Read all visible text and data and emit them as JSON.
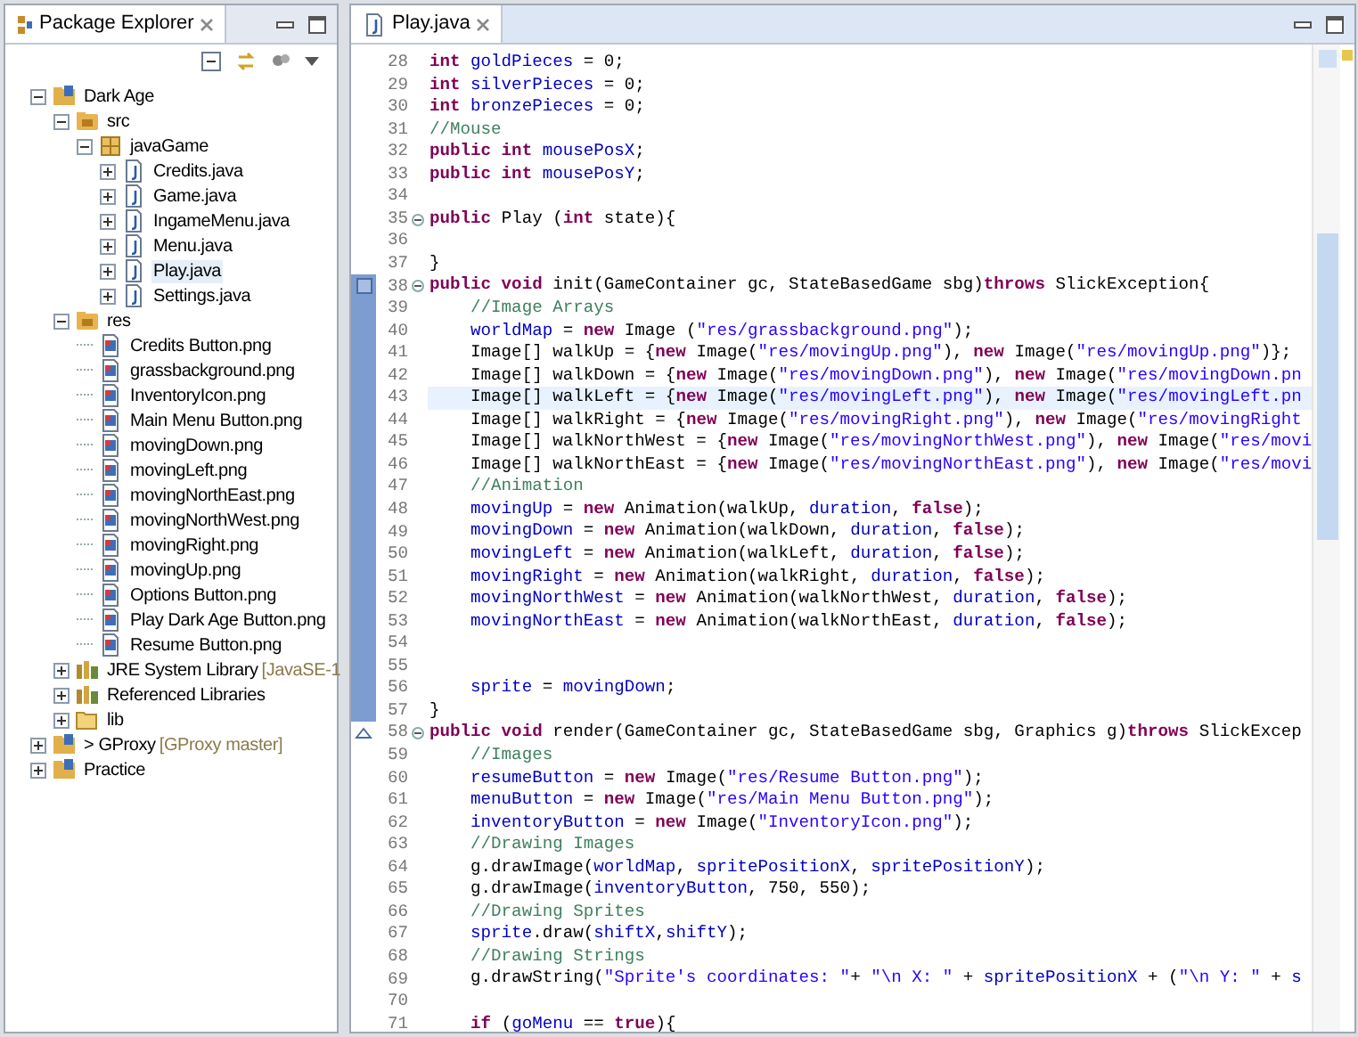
{
  "package_explorer": {
    "title": "Package Explorer",
    "tree": [
      {
        "label": "Dark Age",
        "kind": "project",
        "expanded": true,
        "selected": false,
        "children": [
          {
            "label": "src",
            "kind": "source_folder",
            "expanded": true,
            "selected": false,
            "children": [
              {
                "label": "javaGame",
                "kind": "package",
                "expanded": true,
                "selected": false,
                "children": [
                  {
                    "label": "Credits.java",
                    "kind": "java_file",
                    "expanded": false,
                    "selected": false
                  },
                  {
                    "label": "Game.java",
                    "kind": "java_file",
                    "expanded": false,
                    "selected": false
                  },
                  {
                    "label": "IngameMenu.java",
                    "kind": "java_file",
                    "expanded": false,
                    "selected": false
                  },
                  {
                    "label": "Menu.java",
                    "kind": "java_file",
                    "expanded": false,
                    "selected": false
                  },
                  {
                    "label": "Play.java",
                    "kind": "java_file",
                    "expanded": false,
                    "selected": true
                  },
                  {
                    "label": "Settings.java",
                    "kind": "java_file",
                    "expanded": false,
                    "selected": false
                  }
                ]
              }
            ]
          },
          {
            "label": "res",
            "kind": "source_folder",
            "expanded": true,
            "selected": false,
            "children": [
              {
                "label": "Credits Button.png",
                "kind": "image_file",
                "selected": false
              },
              {
                "label": "grassbackground.png",
                "kind": "image_file",
                "selected": false
              },
              {
                "label": "InventoryIcon.png",
                "kind": "image_file",
                "selected": false
              },
              {
                "label": "Main Menu Button.png",
                "kind": "image_file",
                "selected": false
              },
              {
                "label": "movingDown.png",
                "kind": "image_file",
                "selected": false
              },
              {
                "label": "movingLeft.png",
                "kind": "image_file",
                "selected": false
              },
              {
                "label": "movingNorthEast.png",
                "kind": "image_file",
                "selected": false
              },
              {
                "label": "movingNorthWest.png",
                "kind": "image_file",
                "selected": false
              },
              {
                "label": "movingRight.png",
                "kind": "image_file",
                "selected": false
              },
              {
                "label": "movingUp.png",
                "kind": "image_file",
                "selected": false
              },
              {
                "label": "Options Button.png",
                "kind": "image_file",
                "selected": false
              },
              {
                "label": "Play Dark Age Button.png",
                "kind": "image_file",
                "selected": false
              },
              {
                "label": "Resume Button.png",
                "kind": "image_file",
                "selected": false
              }
            ]
          },
          {
            "label": "JRE System Library",
            "decoration": "[JavaSE-1",
            "kind": "library",
            "expanded": false,
            "selected": false
          },
          {
            "label": "Referenced Libraries",
            "kind": "library",
            "expanded": false,
            "selected": false
          },
          {
            "label": "lib",
            "kind": "folder",
            "expanded": false,
            "selected": false
          }
        ]
      },
      {
        "label": "> GProxy",
        "decoration": "[GProxy master]",
        "kind": "project",
        "expanded": false,
        "selected": false
      },
      {
        "label": "Practice",
        "kind": "project",
        "expanded": false,
        "selected": false
      }
    ]
  },
  "editor": {
    "tabs": [
      {
        "label": "Play.java",
        "selected": true
      }
    ],
    "lines": [
      {
        "number": "28",
        "fold": false,
        "current": false,
        "range": false,
        "tokens": [
          {
            "kind": "keyword",
            "text": "int "
          },
          {
            "kind": "field",
            "text": "goldPieces"
          },
          {
            "kind": "plain",
            "text": " = 0;"
          }
        ]
      },
      {
        "number": "29",
        "fold": false,
        "current": false,
        "range": false,
        "tokens": [
          {
            "kind": "keyword",
            "text": "int "
          },
          {
            "kind": "field",
            "text": "silverPieces"
          },
          {
            "kind": "plain",
            "text": " = 0;"
          }
        ]
      },
      {
        "number": "30",
        "fold": false,
        "current": false,
        "range": false,
        "tokens": [
          {
            "kind": "keyword",
            "text": "int "
          },
          {
            "kind": "field",
            "text": "bronzePieces"
          },
          {
            "kind": "plain",
            "text": " = 0;"
          }
        ]
      },
      {
        "number": "31",
        "fold": false,
        "current": false,
        "range": false,
        "tokens": [
          {
            "kind": "comment",
            "text": "//Mouse"
          }
        ]
      },
      {
        "number": "32",
        "fold": false,
        "current": false,
        "range": false,
        "tokens": [
          {
            "kind": "keyword",
            "text": "public int "
          },
          {
            "kind": "field",
            "text": "mousePosX"
          },
          {
            "kind": "plain",
            "text": ";"
          }
        ]
      },
      {
        "number": "33",
        "fold": false,
        "current": false,
        "range": false,
        "tokens": [
          {
            "kind": "keyword",
            "text": "public int "
          },
          {
            "kind": "field",
            "text": "mousePosY"
          },
          {
            "kind": "plain",
            "text": ";"
          }
        ]
      },
      {
        "number": "34",
        "fold": false,
        "current": false,
        "range": false
      },
      {
        "number": "35",
        "fold": true,
        "current": false,
        "range": false,
        "tokens": [
          {
            "kind": "keyword",
            "text": "public "
          },
          {
            "kind": "plain",
            "text": "Play ("
          },
          {
            "kind": "keyword",
            "text": "int "
          },
          {
            "kind": "plain",
            "text": "state){"
          }
        ]
      },
      {
        "number": "36",
        "fold": false,
        "current": false,
        "range": false
      },
      {
        "number": "37",
        "fold": false,
        "current": false,
        "range": false,
        "tokens": [
          {
            "kind": "plain",
            "text": "}"
          }
        ]
      },
      {
        "number": "38",
        "fold": true,
        "current": false,
        "range": true,
        "occurrence_mark": true,
        "tokens": [
          {
            "kind": "keyword",
            "text": "public void "
          },
          {
            "kind": "plain",
            "text": "init(GameContainer gc, StateBasedGame sbg)"
          },
          {
            "kind": "keyword",
            "text": "throws "
          },
          {
            "kind": "plain",
            "text": "SlickException{"
          }
        ]
      },
      {
        "number": "39",
        "fold": false,
        "current": false,
        "range": true,
        "tokens": [
          {
            "kind": "comment",
            "text": "    //Image Arrays"
          }
        ]
      },
      {
        "number": "40",
        "fold": false,
        "current": false,
        "range": true,
        "tokens": [
          {
            "kind": "field",
            "text": "    worldMap"
          },
          {
            "kind": "plain",
            "text": " = "
          },
          {
            "kind": "keyword",
            "text": "new "
          },
          {
            "kind": "plain",
            "text": "Image ("
          },
          {
            "kind": "string",
            "text": "\"res/grassbackground.png\""
          },
          {
            "kind": "plain",
            "text": ");"
          }
        ]
      },
      {
        "number": "41",
        "fold": false,
        "current": false,
        "range": true,
        "tokens": [
          {
            "kind": "plain",
            "text": "    Image[] walkUp = {"
          },
          {
            "kind": "keyword",
            "text": "new "
          },
          {
            "kind": "plain",
            "text": "Image("
          },
          {
            "kind": "string",
            "text": "\"res/movingUp.png\""
          },
          {
            "kind": "plain",
            "text": "), "
          },
          {
            "kind": "keyword",
            "text": "new "
          },
          {
            "kind": "plain",
            "text": "Image("
          },
          {
            "kind": "string",
            "text": "\"res/movingUp.png\""
          },
          {
            "kind": "plain",
            "text": ")};"
          }
        ]
      },
      {
        "number": "42",
        "fold": false,
        "current": false,
        "range": true,
        "tokens": [
          {
            "kind": "plain",
            "text": "    Image[] walkDown = {"
          },
          {
            "kind": "keyword",
            "text": "new "
          },
          {
            "kind": "plain",
            "text": "Image("
          },
          {
            "kind": "string",
            "text": "\"res/movingDown.png\""
          },
          {
            "kind": "plain",
            "text": "), "
          },
          {
            "kind": "keyword",
            "text": "new "
          },
          {
            "kind": "plain",
            "text": "Image("
          },
          {
            "kind": "string",
            "text": "\"res/movingDown.pn"
          }
        ]
      },
      {
        "number": "43",
        "fold": false,
        "current": true,
        "range": true,
        "tokens": [
          {
            "kind": "plain",
            "text": "    Image[] walkLeft = {"
          },
          {
            "kind": "keyword",
            "text": "new "
          },
          {
            "kind": "plain",
            "text": "Image("
          },
          {
            "kind": "string",
            "text": "\"res/movingLeft.png\""
          },
          {
            "kind": "plain",
            "text": "), "
          },
          {
            "kind": "keyword",
            "text": "new "
          },
          {
            "kind": "plain",
            "text": "Image("
          },
          {
            "kind": "string",
            "text": "\"res/movingLeft.pn"
          }
        ]
      },
      {
        "number": "44",
        "fold": false,
        "current": false,
        "range": true,
        "tokens": [
          {
            "kind": "plain",
            "text": "    Image[] walkRight = {"
          },
          {
            "kind": "keyword",
            "text": "new "
          },
          {
            "kind": "plain",
            "text": "Image("
          },
          {
            "kind": "string",
            "text": "\"res/movingRight.png\""
          },
          {
            "kind": "plain",
            "text": "), "
          },
          {
            "kind": "keyword",
            "text": "new "
          },
          {
            "kind": "plain",
            "text": "Image("
          },
          {
            "kind": "string",
            "text": "\"res/movingRight"
          }
        ]
      },
      {
        "number": "45",
        "fold": false,
        "current": false,
        "range": true,
        "tokens": [
          {
            "kind": "plain",
            "text": "    Image[] walkNorthWest = {"
          },
          {
            "kind": "keyword",
            "text": "new "
          },
          {
            "kind": "plain",
            "text": "Image("
          },
          {
            "kind": "string",
            "text": "\"res/movingNorthWest.png\""
          },
          {
            "kind": "plain",
            "text": "), "
          },
          {
            "kind": "keyword",
            "text": "new "
          },
          {
            "kind": "plain",
            "text": "Image("
          },
          {
            "kind": "string",
            "text": "\"res/movi"
          }
        ]
      },
      {
        "number": "46",
        "fold": false,
        "current": false,
        "range": true,
        "tokens": [
          {
            "kind": "plain",
            "text": "    Image[] walkNorthEast = {"
          },
          {
            "kind": "keyword",
            "text": "new "
          },
          {
            "kind": "plain",
            "text": "Image("
          },
          {
            "kind": "string",
            "text": "\"res/movingNorthEast.png\""
          },
          {
            "kind": "plain",
            "text": "), "
          },
          {
            "kind": "keyword",
            "text": "new "
          },
          {
            "kind": "plain",
            "text": "Image("
          },
          {
            "kind": "string",
            "text": "\"res/movi"
          }
        ]
      },
      {
        "number": "47",
        "fold": false,
        "current": false,
        "range": true,
        "tokens": [
          {
            "kind": "comment",
            "text": "    //Animation"
          }
        ]
      },
      {
        "number": "48",
        "fold": false,
        "current": false,
        "range": true,
        "tokens": [
          {
            "kind": "field",
            "text": "    movingUp"
          },
          {
            "kind": "plain",
            "text": " = "
          },
          {
            "kind": "keyword",
            "text": "new "
          },
          {
            "kind": "plain",
            "text": "Animation(walkUp, "
          },
          {
            "kind": "field",
            "text": "duration"
          },
          {
            "kind": "plain",
            "text": ", "
          },
          {
            "kind": "keyword",
            "text": "false"
          },
          {
            "kind": "plain",
            "text": ");"
          }
        ]
      },
      {
        "number": "49",
        "fold": false,
        "current": false,
        "range": true,
        "tokens": [
          {
            "kind": "field",
            "text": "    movingDown"
          },
          {
            "kind": "plain",
            "text": " = "
          },
          {
            "kind": "keyword",
            "text": "new "
          },
          {
            "kind": "plain",
            "text": "Animation(walkDown, "
          },
          {
            "kind": "field",
            "text": "duration"
          },
          {
            "kind": "plain",
            "text": ", "
          },
          {
            "kind": "keyword",
            "text": "false"
          },
          {
            "kind": "plain",
            "text": ");"
          }
        ]
      },
      {
        "number": "50",
        "fold": false,
        "current": false,
        "range": true,
        "tokens": [
          {
            "kind": "field",
            "text": "    movingLeft"
          },
          {
            "kind": "plain",
            "text": " = "
          },
          {
            "kind": "keyword",
            "text": "new "
          },
          {
            "kind": "plain",
            "text": "Animation(walkLeft, "
          },
          {
            "kind": "field",
            "text": "duration"
          },
          {
            "kind": "plain",
            "text": ", "
          },
          {
            "kind": "keyword",
            "text": "false"
          },
          {
            "kind": "plain",
            "text": ");"
          }
        ]
      },
      {
        "number": "51",
        "fold": false,
        "current": false,
        "range": true,
        "tokens": [
          {
            "kind": "field",
            "text": "    movingRight"
          },
          {
            "kind": "plain",
            "text": " = "
          },
          {
            "kind": "keyword",
            "text": "new "
          },
          {
            "kind": "plain",
            "text": "Animation(walkRight, "
          },
          {
            "kind": "field",
            "text": "duration"
          },
          {
            "kind": "plain",
            "text": ", "
          },
          {
            "kind": "keyword",
            "text": "false"
          },
          {
            "kind": "plain",
            "text": ");"
          }
        ]
      },
      {
        "number": "52",
        "fold": false,
        "current": false,
        "range": true,
        "tokens": [
          {
            "kind": "field",
            "text": "    movingNorthWest"
          },
          {
            "kind": "plain",
            "text": " = "
          },
          {
            "kind": "keyword",
            "text": "new "
          },
          {
            "kind": "plain",
            "text": "Animation(walkNorthWest, "
          },
          {
            "kind": "field",
            "text": "duration"
          },
          {
            "kind": "plain",
            "text": ", "
          },
          {
            "kind": "keyword",
            "text": "false"
          },
          {
            "kind": "plain",
            "text": ");"
          }
        ]
      },
      {
        "number": "53",
        "fold": false,
        "current": false,
        "range": true,
        "tokens": [
          {
            "kind": "field",
            "text": "    movingNorthEast"
          },
          {
            "kind": "plain",
            "text": " = "
          },
          {
            "kind": "keyword",
            "text": "new "
          },
          {
            "kind": "plain",
            "text": "Animation(walkNorthEast, "
          },
          {
            "kind": "field",
            "text": "duration"
          },
          {
            "kind": "plain",
            "text": ", "
          },
          {
            "kind": "keyword",
            "text": "false"
          },
          {
            "kind": "plain",
            "text": ");"
          }
        ]
      },
      {
        "number": "54",
        "fold": false,
        "current": false,
        "range": true
      },
      {
        "number": "55",
        "fold": false,
        "current": false,
        "range": true
      },
      {
        "number": "56",
        "fold": false,
        "current": false,
        "range": true,
        "tokens": [
          {
            "kind": "field",
            "text": "    sprite"
          },
          {
            "kind": "plain",
            "text": " = "
          },
          {
            "kind": "field",
            "text": "movingDown"
          },
          {
            "kind": "plain",
            "text": ";"
          }
        ]
      },
      {
        "number": "57",
        "fold": false,
        "current": false,
        "range": true,
        "tokens": [
          {
            "kind": "plain",
            "text": "}"
          }
        ]
      },
      {
        "number": "58",
        "fold": true,
        "current": false,
        "range": false,
        "override_mark": true,
        "tokens": [
          {
            "kind": "keyword",
            "text": "public void "
          },
          {
            "kind": "plain",
            "text": "render(GameContainer gc, StateBasedGame sbg, Graphics g)"
          },
          {
            "kind": "keyword",
            "text": "throws "
          },
          {
            "kind": "plain",
            "text": "SlickExcep"
          }
        ]
      },
      {
        "number": "59",
        "fold": false,
        "current": false,
        "range": false,
        "tokens": [
          {
            "kind": "comment",
            "text": "    //Images"
          }
        ]
      },
      {
        "number": "60",
        "fold": false,
        "current": false,
        "range": false,
        "tokens": [
          {
            "kind": "field",
            "text": "    resumeButton"
          },
          {
            "kind": "plain",
            "text": " = "
          },
          {
            "kind": "keyword",
            "text": "new "
          },
          {
            "kind": "plain",
            "text": "Image("
          },
          {
            "kind": "string",
            "text": "\"res/Resume Button.png\""
          },
          {
            "kind": "plain",
            "text": ");"
          }
        ]
      },
      {
        "number": "61",
        "fold": false,
        "current": false,
        "range": false,
        "tokens": [
          {
            "kind": "field",
            "text": "    menuButton"
          },
          {
            "kind": "plain",
            "text": " = "
          },
          {
            "kind": "keyword",
            "text": "new "
          },
          {
            "kind": "plain",
            "text": "Image("
          },
          {
            "kind": "string",
            "text": "\"res/Main Menu Button.png\""
          },
          {
            "kind": "plain",
            "text": ");"
          }
        ]
      },
      {
        "number": "62",
        "fold": false,
        "current": false,
        "range": false,
        "tokens": [
          {
            "kind": "field",
            "text": "    inventoryButton"
          },
          {
            "kind": "plain",
            "text": " = "
          },
          {
            "kind": "keyword",
            "text": "new "
          },
          {
            "kind": "plain",
            "text": "Image("
          },
          {
            "kind": "string",
            "text": "\"InventoryIcon.png\""
          },
          {
            "kind": "plain",
            "text": ");"
          }
        ]
      },
      {
        "number": "63",
        "fold": false,
        "current": false,
        "range": false,
        "tokens": [
          {
            "kind": "comment",
            "text": "    //Drawing Images"
          }
        ]
      },
      {
        "number": "64",
        "fold": false,
        "current": false,
        "range": false,
        "tokens": [
          {
            "kind": "plain",
            "text": "    g.drawImage("
          },
          {
            "kind": "field",
            "text": "worldMap"
          },
          {
            "kind": "plain",
            "text": ", "
          },
          {
            "kind": "field",
            "text": "spritePositionX"
          },
          {
            "kind": "plain",
            "text": ", "
          },
          {
            "kind": "field",
            "text": "spritePositionY"
          },
          {
            "kind": "plain",
            "text": ");"
          }
        ]
      },
      {
        "number": "65",
        "fold": false,
        "current": false,
        "range": false,
        "tokens": [
          {
            "kind": "plain",
            "text": "    g.drawImage("
          },
          {
            "kind": "field",
            "text": "inventoryButton"
          },
          {
            "kind": "plain",
            "text": ", 750, 550);"
          }
        ]
      },
      {
        "number": "66",
        "fold": false,
        "current": false,
        "range": false,
        "tokens": [
          {
            "kind": "comment",
            "text": "    //Drawing Sprites"
          }
        ]
      },
      {
        "number": "67",
        "fold": false,
        "current": false,
        "range": false,
        "tokens": [
          {
            "kind": "field",
            "text": "    sprite"
          },
          {
            "kind": "plain",
            "text": ".draw("
          },
          {
            "kind": "field",
            "text": "shiftX"
          },
          {
            "kind": "plain",
            "text": ","
          },
          {
            "kind": "field",
            "text": "shiftY"
          },
          {
            "kind": "plain",
            "text": ");"
          }
        ]
      },
      {
        "number": "68",
        "fold": false,
        "current": false,
        "range": false,
        "tokens": [
          {
            "kind": "comment",
            "text": "    //Drawing Strings"
          }
        ]
      },
      {
        "number": "69",
        "fold": false,
        "current": false,
        "range": false,
        "tokens": [
          {
            "kind": "plain",
            "text": "    g.drawString("
          },
          {
            "kind": "string",
            "text": "\"Sprite's coordinates: \""
          },
          {
            "kind": "plain",
            "text": "+ "
          },
          {
            "kind": "string",
            "text": "\"\\n X: \""
          },
          {
            "kind": "plain",
            "text": " + "
          },
          {
            "kind": "field",
            "text": "spritePositionX"
          },
          {
            "kind": "plain",
            "text": " + ("
          },
          {
            "kind": "string",
            "text": "\"\\n Y: \""
          },
          {
            "kind": "plain",
            "text": " + "
          },
          {
            "kind": "field",
            "text": "s"
          }
        ]
      },
      {
        "number": "70",
        "fold": false,
        "current": false,
        "range": false
      },
      {
        "number": "71",
        "fold": false,
        "current": false,
        "range": false,
        "tokens": [
          {
            "kind": "keyword",
            "text": "    if "
          },
          {
            "kind": "plain",
            "text": "("
          },
          {
            "kind": "field",
            "text": "goMenu"
          },
          {
            "kind": "plain",
            "text": " == "
          },
          {
            "kind": "keyword",
            "text": "true"
          },
          {
            "kind": "plain",
            "text": "){"
          }
        ]
      }
    ]
  }
}
